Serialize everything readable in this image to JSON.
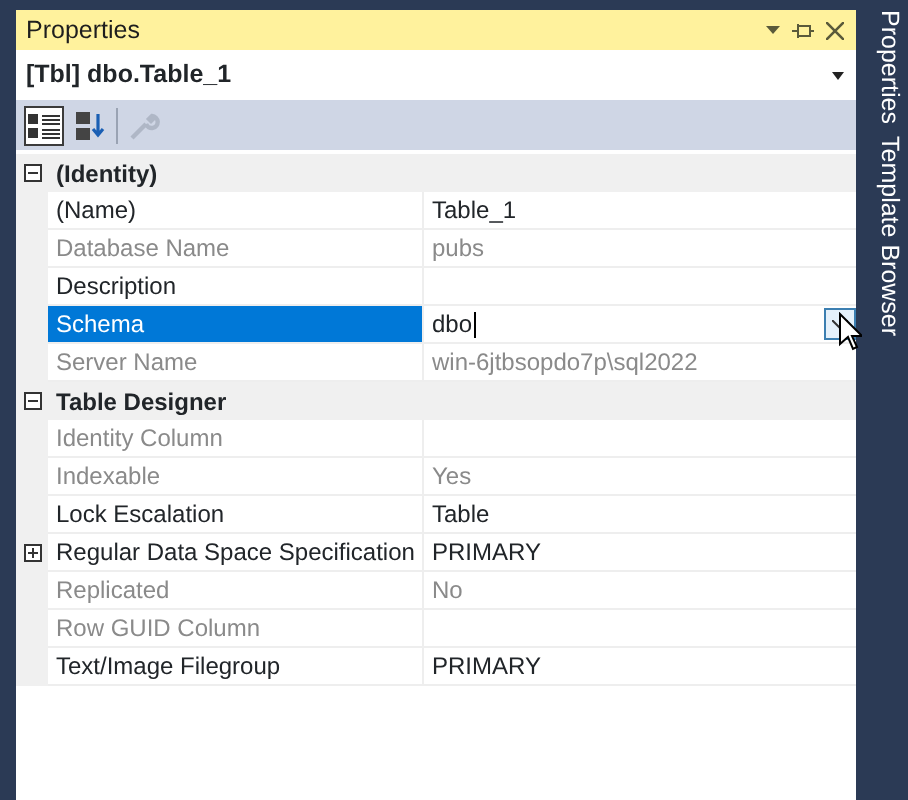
{
  "panel": {
    "title": "Properties",
    "object": "[Tbl] dbo.Table_1"
  },
  "toolbar": [
    {
      "kind": "categorized",
      "selected": true,
      "disabled": false
    },
    {
      "kind": "alphabetical",
      "selected": false,
      "disabled": false
    },
    {
      "kind": "pages",
      "selected": false,
      "disabled": true
    }
  ],
  "grid": [
    {
      "kind": "category",
      "name": "(Identity)",
      "expanded": true
    },
    {
      "kind": "property",
      "name": "(Name)",
      "value": "Table_1",
      "disabled": false,
      "selected": false
    },
    {
      "kind": "property",
      "name": "Database Name",
      "value": "pubs",
      "disabled": true,
      "selected": false
    },
    {
      "kind": "property",
      "name": "Description",
      "disabled": false,
      "selected": false
    },
    {
      "kind": "property",
      "name": "Schema",
      "value": "dbo",
      "disabled": false,
      "selected": true
    },
    {
      "kind": "property",
      "name": "Server Name",
      "value": "win-6jtbsopdo7p\\sql2022",
      "disabled": true,
      "selected": false
    },
    {
      "kind": "category",
      "name": "Table Designer",
      "expanded": true
    },
    {
      "kind": "property",
      "name": "Identity Column",
      "disabled": true,
      "selected": false
    },
    {
      "kind": "property",
      "name": "Indexable",
      "value": "Yes",
      "disabled": true,
      "selected": false
    },
    {
      "kind": "property",
      "name": "Lock Escalation",
      "value": "Table",
      "disabled": false,
      "selected": false
    },
    {
      "kind": "property",
      "name": "Regular Data Space Specification",
      "value": "PRIMARY",
      "disabled": false,
      "selected": false,
      "expanded": false
    },
    {
      "kind": "property",
      "name": "Replicated",
      "value": "No",
      "disabled": true,
      "selected": false
    },
    {
      "kind": "property",
      "name": "Row GUID Column",
      "disabled": true,
      "selected": false
    },
    {
      "kind": "property",
      "name": "Text/Image Filegroup",
      "value": "PRIMARY",
      "disabled": false,
      "selected": false
    }
  ],
  "side_tabs": [
    {
      "label": "Properties"
    },
    {
      "label": "Template Browser"
    }
  ]
}
